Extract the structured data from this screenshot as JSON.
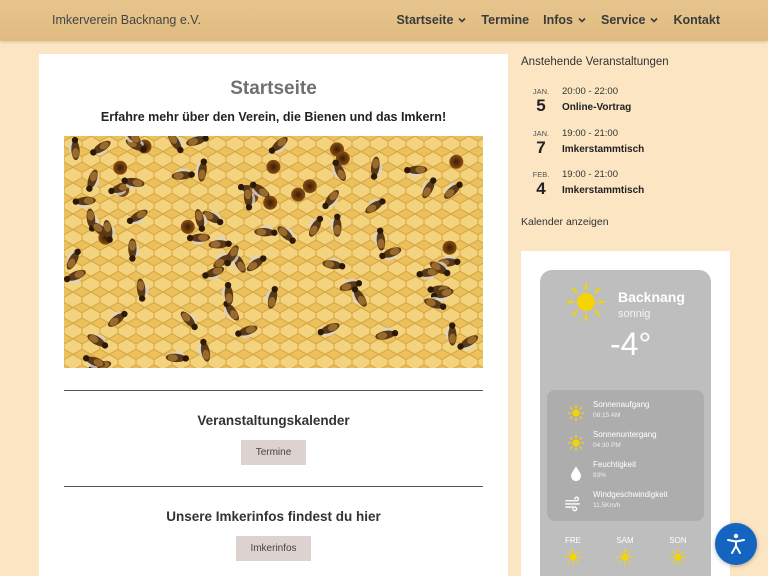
{
  "header": {
    "site_title": "Imkerverein Backnang e.V.",
    "nav": [
      {
        "label": "Startseite",
        "dropdown": true
      },
      {
        "label": "Termine",
        "dropdown": false
      },
      {
        "label": "Infos",
        "dropdown": true
      },
      {
        "label": "Service",
        "dropdown": true
      },
      {
        "label": "Kontakt",
        "dropdown": false
      }
    ]
  },
  "main": {
    "title": "Startseite",
    "subtitle": "Erfahre mehr über den Verein, die Bienen und das Imkern!",
    "sections": [
      {
        "title": "Veranstaltungskalender",
        "button": "Termine"
      },
      {
        "title": "Unsere Imkerinfos findest du hier",
        "button": "Imkerinfos"
      }
    ]
  },
  "events": {
    "heading": "Anstehende Veranstaltungen",
    "items": [
      {
        "month": "JAN.",
        "day": "5",
        "time": "20:00 - 22:00",
        "title": "Online-Vortrag"
      },
      {
        "month": "JAN.",
        "day": "7",
        "time": "19:00 - 21:00",
        "title": "Imkerstammtisch"
      },
      {
        "month": "FEB.",
        "day": "4",
        "time": "19:00 - 21:00",
        "title": "Imkerstammtisch"
      }
    ],
    "calendar_link": "Kalender anzeigen"
  },
  "weather": {
    "city": "Backnang",
    "condition": "sonnig",
    "temperature": "-4°",
    "details": [
      {
        "label": "Sonnenaufgang",
        "value": "08:15 AM",
        "icon": "sunrise-icon"
      },
      {
        "label": "Sonnenuntergang",
        "value": "04:30 PM",
        "icon": "sunset-icon"
      },
      {
        "label": "Feuchtigkeit",
        "value": "93%",
        "icon": "droplet-icon"
      },
      {
        "label": "Windgeschwindigkeit",
        "value": "11.5Km/h",
        "icon": "wind-icon"
      }
    ],
    "forecast": [
      {
        "day": "FRE",
        "icon": "sun-icon"
      },
      {
        "day": "SAM",
        "icon": "sun-icon"
      },
      {
        "day": "SON",
        "icon": "sun-icon"
      }
    ],
    "icon_color": "#f5d400"
  },
  "colors": {
    "background": "#fbe5c2",
    "header": "#e2bf85",
    "accessibility": "#1565c0"
  }
}
